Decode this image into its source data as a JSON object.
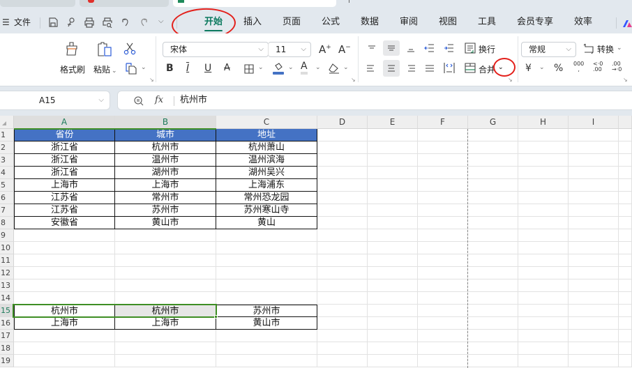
{
  "window": {
    "browser_tabs": [
      {
        "state": "inactive",
        "icon": "app-tab-icon"
      },
      {
        "state": "inactive",
        "icon": "pdf-tab-icon",
        "icon_color": "#e0302b"
      },
      {
        "state": "active",
        "icon": "spreadsheet-tab-icon",
        "icon_color": "#1f8a5b"
      }
    ]
  },
  "menubar": {
    "file_label": "文件",
    "quick_access": [
      "save-icon",
      "export-icon",
      "print-icon",
      "print-preview-icon",
      "undo-icon",
      "redo-icon",
      "more-chevron-icon"
    ],
    "tabs": [
      {
        "label": "开始",
        "active": true
      },
      {
        "label": "插入",
        "active": false
      },
      {
        "label": "页面",
        "active": false
      },
      {
        "label": "公式",
        "active": false
      },
      {
        "label": "数据",
        "active": false
      },
      {
        "label": "审阅",
        "active": false
      },
      {
        "label": "视图",
        "active": false
      },
      {
        "label": "工具",
        "active": false
      },
      {
        "label": "会员专享",
        "active": false
      },
      {
        "label": "效率",
        "active": false
      }
    ],
    "accent": "#0d7a5f"
  },
  "ribbon": {
    "clipboard": {
      "format_painter": "格式刷",
      "paste": "粘贴",
      "cut_icon": "scissors-icon",
      "copy_icon": "copy-icon"
    },
    "font": {
      "name": "宋体",
      "size": "11",
      "increase_label": "A",
      "decrease_label": "A",
      "bold": "B",
      "italic": "I",
      "underline": "U",
      "strike": "A",
      "fill_color": "#4472c4",
      "font_color_label": "A"
    },
    "alignment": {
      "wrap_label": "换行",
      "merge_label": "合并"
    },
    "number": {
      "format": "常规",
      "convert_label": "转换",
      "currency_symbol": "¥",
      "percent_symbol": "%",
      "thousands_label": "000",
      "inc_decimal_label": ".00",
      "dec_decimal_label": ".00"
    }
  },
  "formula_bar": {
    "cell_ref": "A15",
    "fx_label": "fx",
    "content": "杭州市"
  },
  "sheet": {
    "columns": [
      "A",
      "B",
      "C",
      "D",
      "E",
      "F",
      "G",
      "H",
      "I"
    ],
    "selected_columns": [
      "A",
      "B"
    ],
    "rows": [
      "1",
      "2",
      "3",
      "4",
      "5",
      "6",
      "7",
      "8",
      "9",
      "10",
      "11",
      "12",
      "13",
      "14",
      "15",
      "16",
      "17",
      "18",
      "19"
    ],
    "selected_row": "15",
    "header_fill": "#4472c4",
    "selection_color": "#3e8e24",
    "table1": {
      "headers": [
        "省份",
        "城市",
        "地址"
      ],
      "rows": [
        [
          "浙江省",
          "杭州市",
          "杭州萧山"
        ],
        [
          "浙江省",
          "温州市",
          "温州滨海"
        ],
        [
          "浙江省",
          "湖州市",
          "湖州吴兴"
        ],
        [
          "上海市",
          "上海市",
          "上海浦东"
        ],
        [
          "江苏省",
          "常州市",
          "常州恐龙园"
        ],
        [
          "江苏省",
          "苏州市",
          "苏州寒山寺"
        ],
        [
          "安徽省",
          "黄山市",
          "黄山"
        ]
      ]
    },
    "table2": {
      "rows": [
        [
          "杭州市",
          "杭州市",
          "苏州市"
        ],
        [
          "上海市",
          "上海市",
          "黄山市"
        ]
      ]
    },
    "selection": "A15:B15",
    "active_cell": "A15"
  }
}
